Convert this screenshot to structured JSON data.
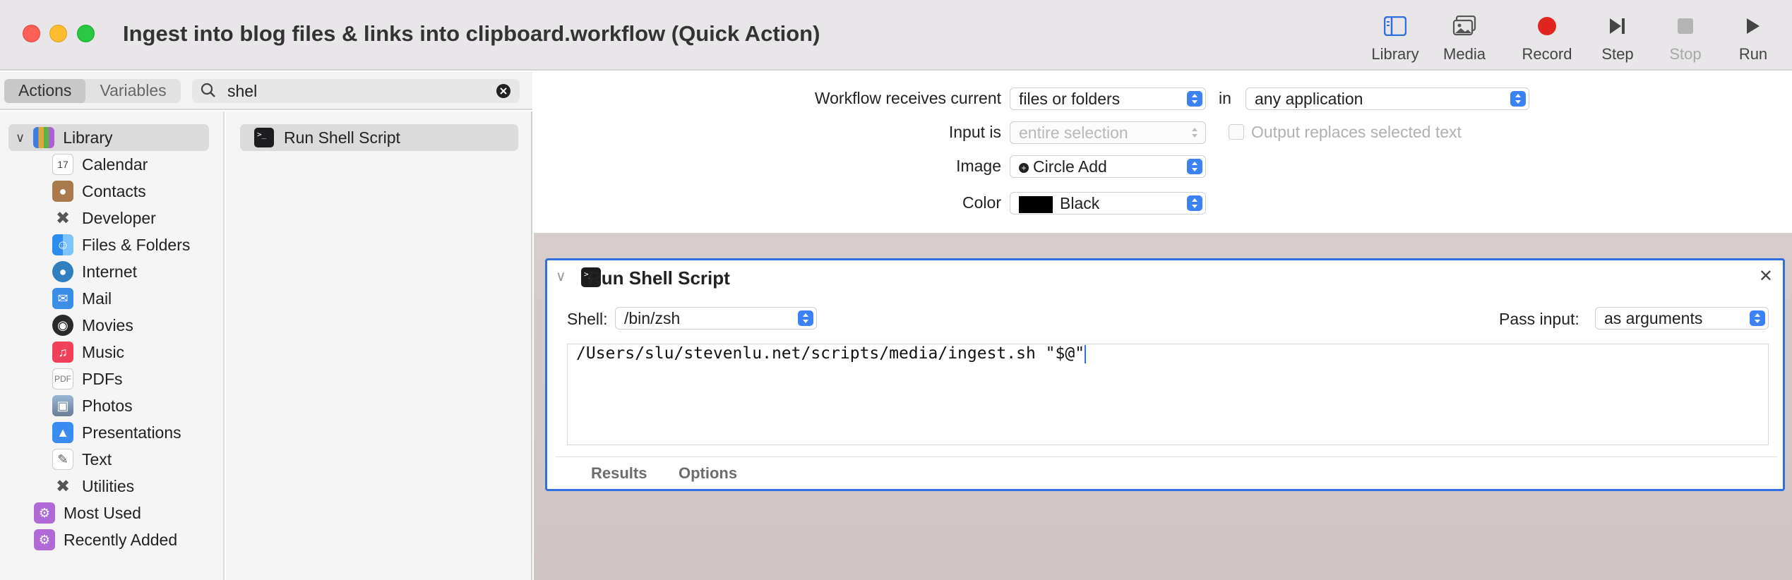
{
  "window": {
    "title": "Ingest into blog files & links into clipboard.workflow (Quick Action)"
  },
  "toolbar": {
    "library": "Library",
    "media": "Media",
    "record": "Record",
    "step": "Step",
    "stop": "Stop",
    "run": "Run"
  },
  "sidebar": {
    "tabs": {
      "actions": "Actions",
      "variables": "Variables"
    },
    "search": {
      "value": "shel"
    },
    "library_root": "Library",
    "items": [
      {
        "label": "Calendar",
        "icon": "calendar-icon"
      },
      {
        "label": "Contacts",
        "icon": "contacts-icon"
      },
      {
        "label": "Developer",
        "icon": "developer-icon"
      },
      {
        "label": "Files & Folders",
        "icon": "finder-icon"
      },
      {
        "label": "Internet",
        "icon": "globe-icon"
      },
      {
        "label": "Mail",
        "icon": "mail-icon"
      },
      {
        "label": "Movies",
        "icon": "movies-icon"
      },
      {
        "label": "Music",
        "icon": "music-icon"
      },
      {
        "label": "PDFs",
        "icon": "pdf-icon"
      },
      {
        "label": "Photos",
        "icon": "photos-icon"
      },
      {
        "label": "Presentations",
        "icon": "keynote-icon"
      },
      {
        "label": "Text",
        "icon": "text-icon"
      },
      {
        "label": "Utilities",
        "icon": "utilities-icon"
      }
    ],
    "smart_groups": [
      {
        "label": "Most Used"
      },
      {
        "label": "Recently Added"
      }
    ]
  },
  "actions_list": [
    {
      "label": "Run Shell Script"
    }
  ],
  "workflow": {
    "receives_label": "Workflow receives current",
    "receives_value": "files or folders",
    "in_label": "in",
    "in_value": "any application",
    "input_is_label": "Input is",
    "input_is_value": "entire selection",
    "output_replaces_label": "Output replaces selected text",
    "image_label": "Image",
    "image_value": "Circle Add",
    "color_label": "Color",
    "color_value": "Black",
    "color_swatch": "#000000"
  },
  "action_card": {
    "title": "Run Shell Script",
    "shell_label": "Shell:",
    "shell_value": "/bin/zsh",
    "pass_input_label": "Pass input:",
    "pass_input_value": "as arguments",
    "script": "/Users/slu/stevenlu.net/scripts/media/ingest.sh \"$@\"",
    "tabs": {
      "results": "Results",
      "options": "Options"
    }
  },
  "colors": {
    "accent": "#2f6fde",
    "record": "#e0261f"
  }
}
